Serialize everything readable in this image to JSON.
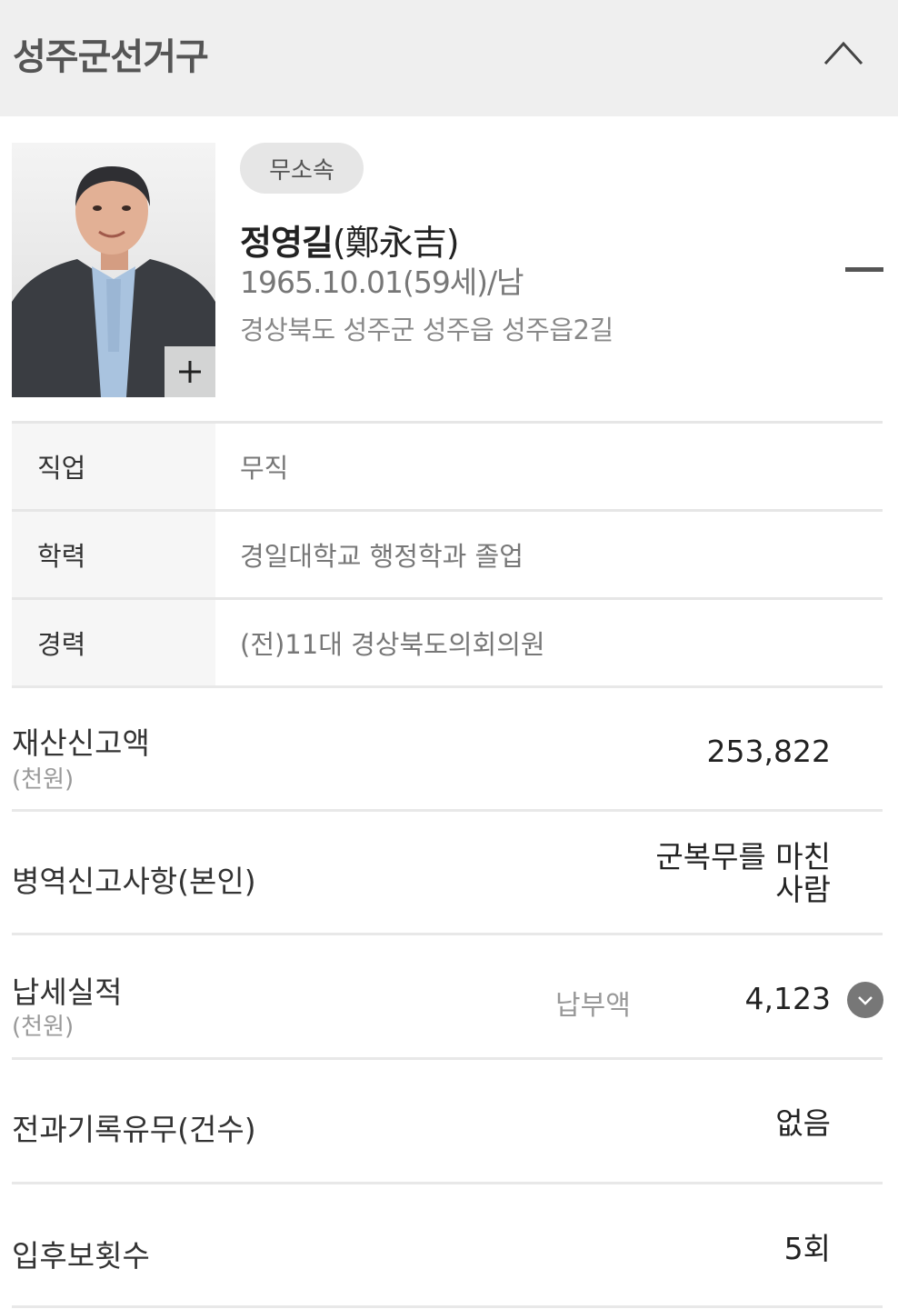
{
  "header": {
    "title": "성주군선거구"
  },
  "candidate": {
    "party": "무소속",
    "name_ko": "정영길",
    "name_hanja": "(鄭永吉)",
    "birth_info": "1965.10.01(59세)/남",
    "address": "경상북도 성주군 성주읍 성주읍2길"
  },
  "profile": [
    {
      "label": "직업",
      "value": "무직"
    },
    {
      "label": "학력",
      "value": "경일대학교 행정학과 졸업"
    },
    {
      "label": "경력",
      "value": "(전)11대 경상북도의회의원"
    }
  ],
  "property": {
    "label": "재산신고액",
    "unit": "(천원)",
    "value": "253,822"
  },
  "military": {
    "label": "병역신고사항(본인)",
    "value_line1": "군복무를 마친",
    "value_line2": "사람"
  },
  "tax": {
    "label": "납세실적",
    "unit": "(천원)",
    "sub_label": "납부액",
    "value": "4,123"
  },
  "criminal": {
    "label": "전과기록유무(건수)",
    "value": "없음"
  },
  "candidacy": {
    "label": "입후보횟수",
    "value": "5회"
  }
}
